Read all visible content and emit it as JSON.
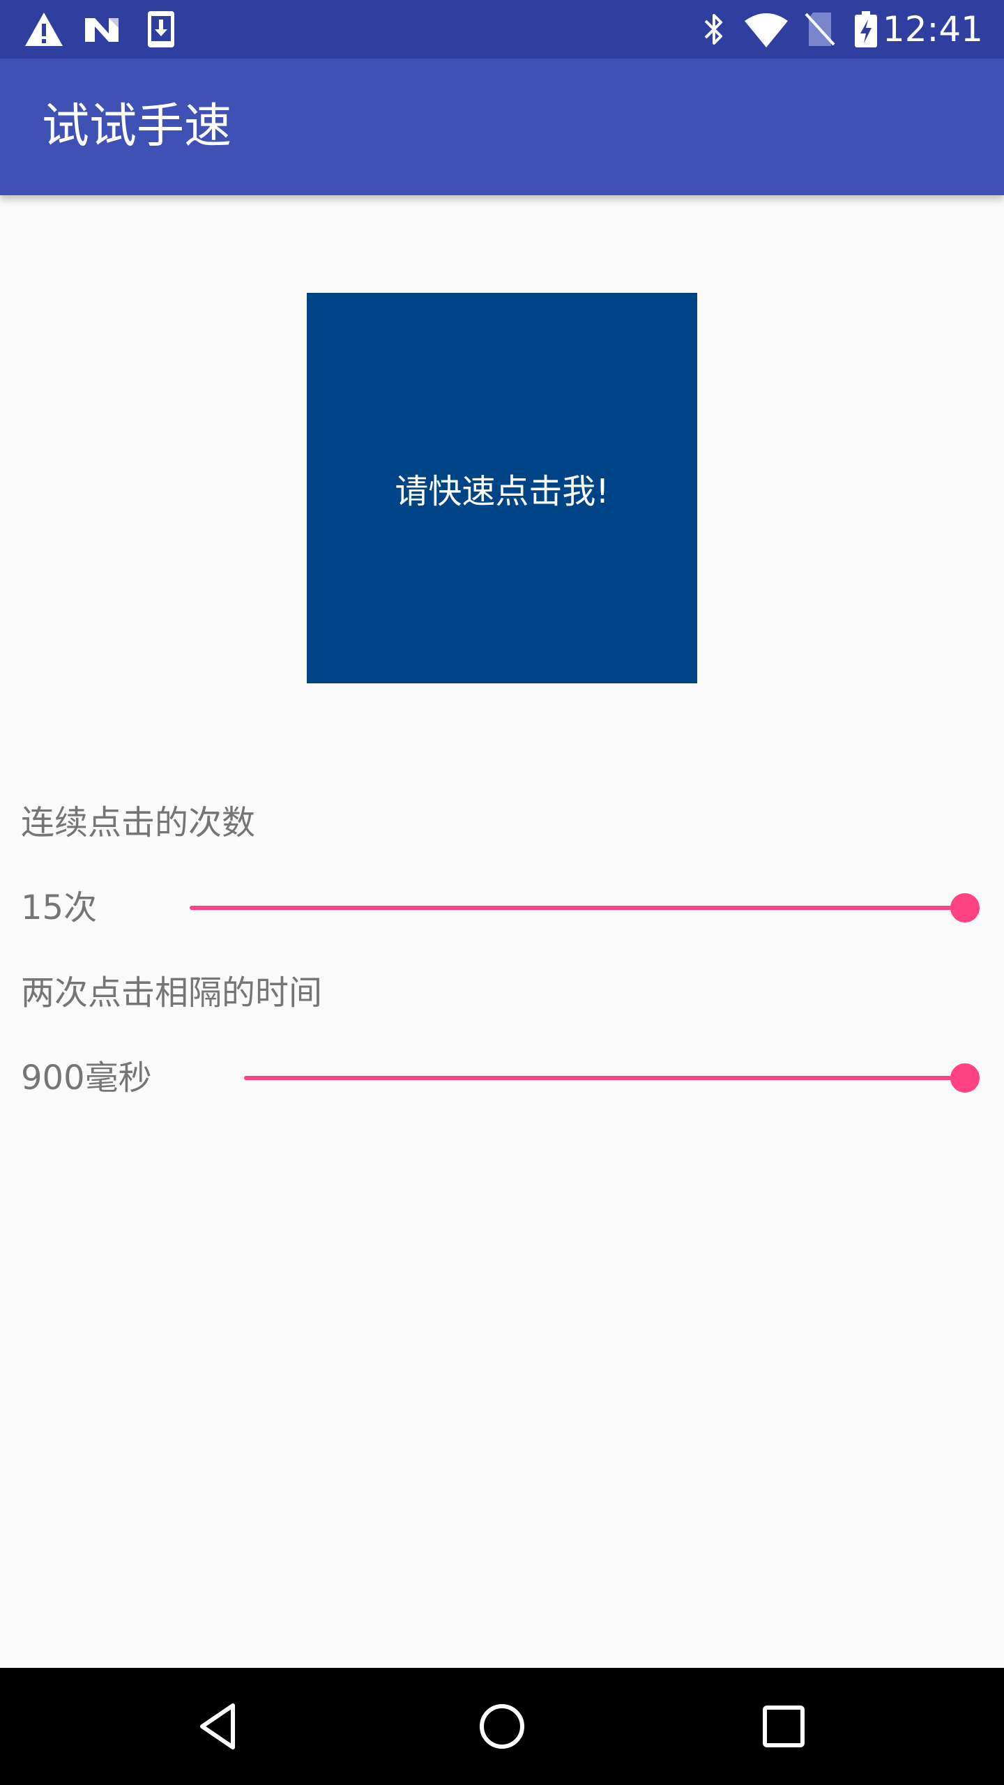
{
  "status_bar": {
    "time": "12:41",
    "icons": [
      "warning-icon",
      "n-notification-icon",
      "download-icon",
      "bluetooth-icon",
      "wifi-icon",
      "no-sim-icon",
      "battery-charging-icon"
    ]
  },
  "app_bar": {
    "title": "试试手速"
  },
  "tap_target": {
    "label": "请快速点击我!",
    "color": "#004488"
  },
  "settings": {
    "click_count": {
      "label": "连续点击的次数",
      "value_label": "15次",
      "level": 1.0
    },
    "interval": {
      "label": "两次点击相隔的时间",
      "value_label": "900毫秒",
      "level": 1.0
    }
  },
  "colors": {
    "status_bar": "#303f9f",
    "app_bar": "#3f51b5",
    "accent": "#ff4081",
    "background": "#fafafa"
  },
  "nav_bar": {
    "buttons": [
      "back-icon",
      "home-icon",
      "recents-icon"
    ]
  }
}
